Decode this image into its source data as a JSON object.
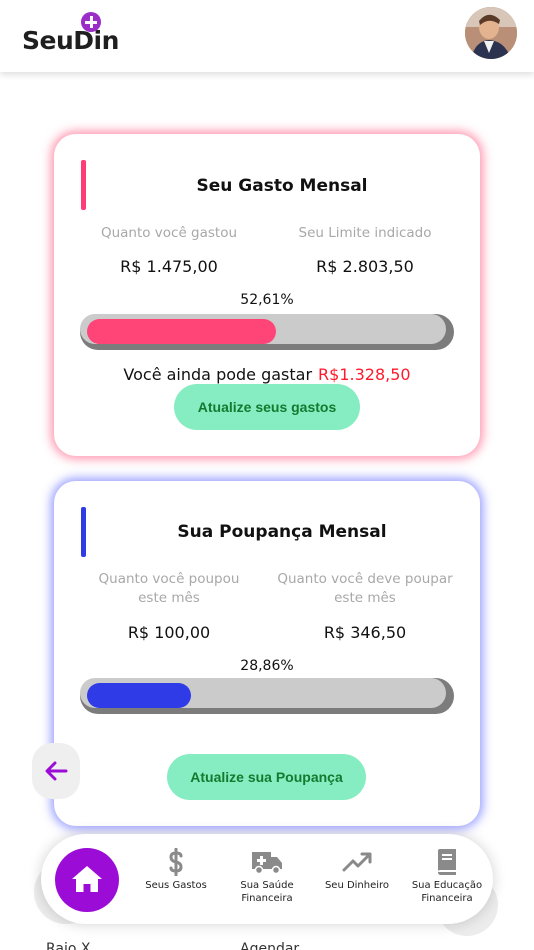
{
  "header": {
    "logo_text": "SeuDin"
  },
  "spend_card": {
    "title": "Seu Gasto Mensal",
    "spent_label": "Quanto você gastou",
    "spent_value": "R$ 1.475,00",
    "limit_label": "Seu Limite indicado",
    "limit_value": "R$ 2.803,50",
    "percent_text": "52,61%",
    "progress_fraction": 0.5261,
    "remaining_label": "Você ainda pode gastar",
    "remaining_value": "R$1.328,50",
    "button_label": "Atualize seus gastos",
    "accent_color": "#ff3c78"
  },
  "save_card": {
    "title": "Sua Poupança Mensal",
    "saved_label": "Quanto você poupou este mês",
    "saved_value": "R$ 100,00",
    "target_label": "Quanto você deve poupar este mês",
    "target_value": "R$ 346,50",
    "percent_text": "28,86%",
    "progress_fraction": 0.2886,
    "button_label": "Atualize sua Poupança",
    "accent_color": "#2f3ce6"
  },
  "bottom_nav": {
    "items": [
      {
        "icon": "home-icon",
        "label": ""
      },
      {
        "icon": "dollar-icon",
        "label": "Seus Gastos"
      },
      {
        "icon": "ambulance-icon",
        "label": "Sua Saúde Financeira"
      },
      {
        "icon": "trend-up-icon",
        "label": "Seu Dinheiro"
      },
      {
        "icon": "book-icon",
        "label": "Sua Educação Financeira"
      }
    ]
  },
  "background_items": {
    "left_label": "Raio X",
    "center_label": "Agendar"
  },
  "colors": {
    "brand_purple": "#9b0cd6",
    "button_green": "#86ecc1",
    "button_text": "#137a2f",
    "remaining_red": "#ff1a2c"
  }
}
